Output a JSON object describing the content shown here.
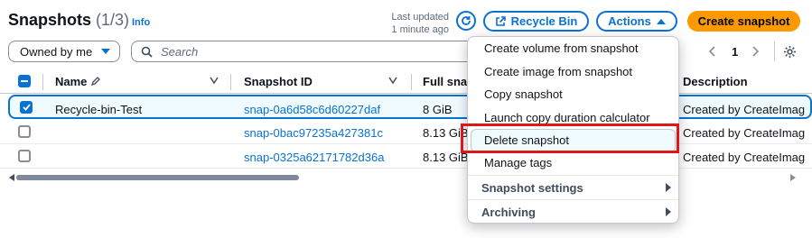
{
  "header": {
    "title": "Snapshots",
    "count": "(1/3)",
    "info": "Info",
    "last_updated_label": "Last updated",
    "last_updated_value": "1 minute ago",
    "recycle_bin": "Recycle Bin",
    "actions": "Actions",
    "create": "Create snapshot"
  },
  "filters": {
    "owner": "Owned by me",
    "search_placeholder": "Search"
  },
  "pagination": {
    "page": "1"
  },
  "table": {
    "columns": [
      "Name",
      "Snapshot ID",
      "Full snap",
      "Description"
    ],
    "rows": [
      {
        "name": "Recycle-bin-Test",
        "id": "snap-0a6d58c6d60227daf",
        "full": "8 GiB",
        "desc": "Created by CreateImag"
      },
      {
        "name": "",
        "id": "snap-0bac97235a427381c",
        "full": "8.13 GiB",
        "desc": "Created by CreateImag"
      },
      {
        "name": "",
        "id": "snap-0325a62171782d36a",
        "full": "8.13 GiB",
        "desc": "Created by CreateImag"
      }
    ]
  },
  "menu": {
    "items": [
      "Create volume from snapshot",
      "Create image from snapshot",
      "Copy snapshot",
      "Launch copy duration calculator",
      "Delete snapshot",
      "Manage tags"
    ],
    "groups": [
      "Snapshot settings",
      "Archiving"
    ]
  },
  "colors": {
    "accent": "#0972d3",
    "primary_button": "#ff9900",
    "highlight_border": "#e01717"
  }
}
